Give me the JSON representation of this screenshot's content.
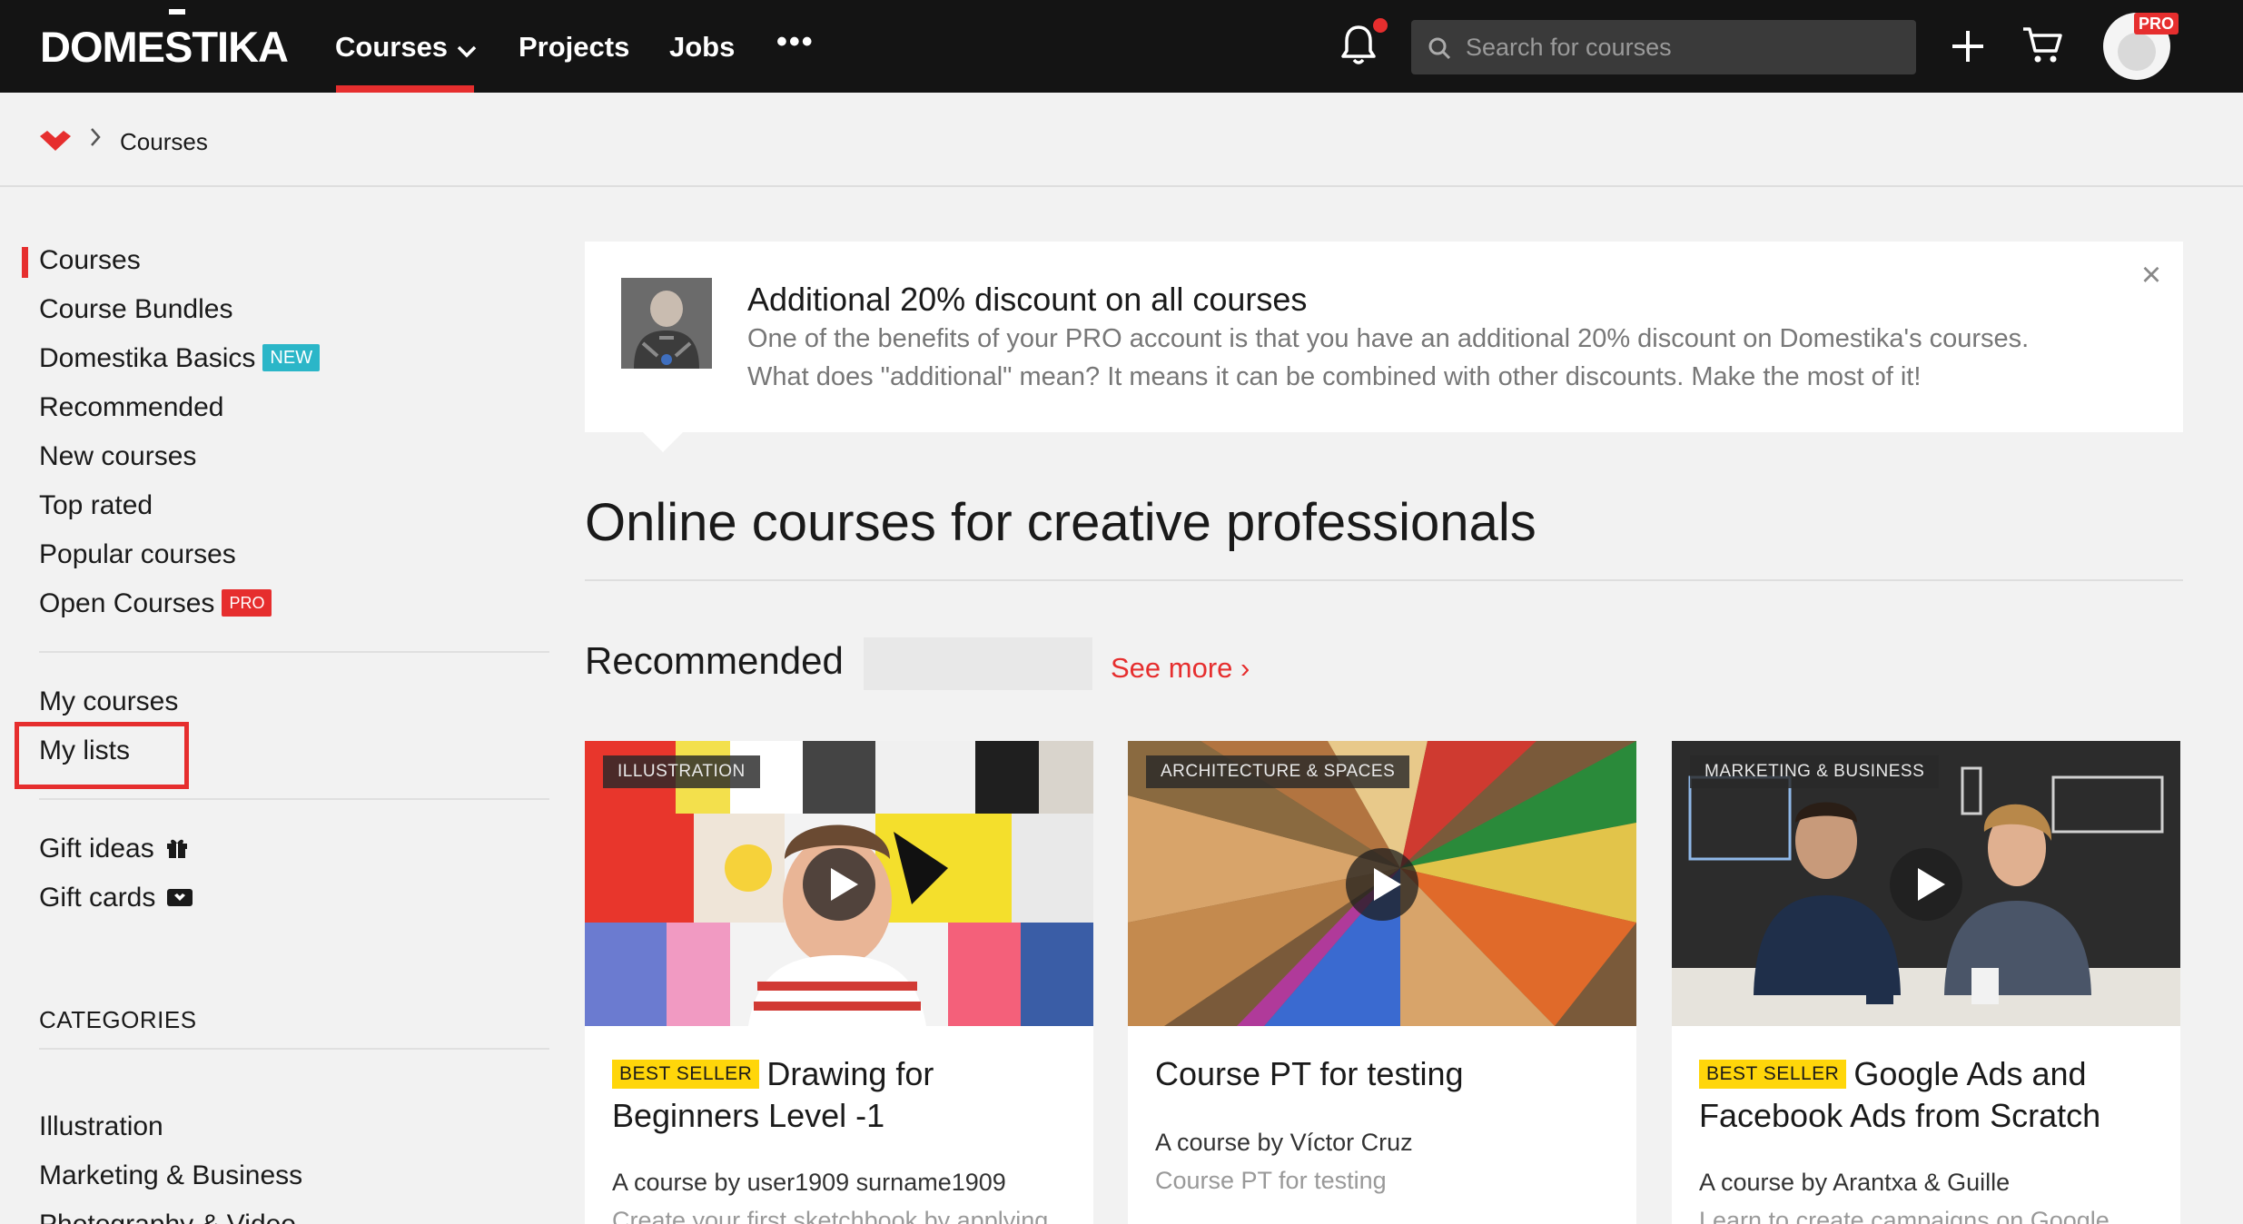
{
  "topnav": {
    "logo": "DOMESTIKA",
    "courses_label": "Courses",
    "projects_label": "Projects",
    "jobs_label": "Jobs",
    "more_label": "•••",
    "search_placeholder": "Search for courses",
    "pro_badge": "PRO",
    "accent_color": "#e62e2e"
  },
  "breadcrumb": {
    "home_icon": "domestika-heart-icon",
    "separator": ">",
    "current": "Courses"
  },
  "sidebar": {
    "items": [
      {
        "label": "Courses",
        "active": true
      },
      {
        "label": "Course Bundles"
      },
      {
        "label": "Domestika Basics",
        "badge": "NEW"
      },
      {
        "label": "Recommended"
      },
      {
        "label": "New courses"
      },
      {
        "label": "Top rated"
      },
      {
        "label": "Popular courses"
      },
      {
        "label": "Open Courses",
        "badge": "PRO"
      }
    ],
    "user_items": [
      {
        "label": "My courses"
      },
      {
        "label": "My lists",
        "highlighted": true
      }
    ],
    "gift_items": [
      {
        "label": "Gift ideas",
        "icon": "gift-icon"
      },
      {
        "label": "Gift cards",
        "icon": "gift-card-icon"
      }
    ],
    "categories_heading": "CATEGORIES",
    "categories": [
      "Illustration",
      "Marketing & Business",
      "Photography & Video"
    ]
  },
  "promo": {
    "title": "Additional 20% discount on all courses",
    "line1": "One of the benefits of your PRO account is that you have an additional 20% discount on Domestika's courses.",
    "line2": "What does \"additional\" mean? It means it can be combined with other discounts. Make the most of it!",
    "close": "×"
  },
  "main": {
    "title": "Online courses for creative professionals",
    "section_title": "Recommended",
    "see_more": "See more ›"
  },
  "cards": [
    {
      "category": "ILLUSTRATION",
      "badge": "BEST SELLER",
      "title": "Drawing for Beginners Level -1",
      "author": "A course by user1909 surname1909",
      "description": "Create your first sketchbook by applying"
    },
    {
      "category": "ARCHITECTURE & SPACES",
      "title": "Course PT for testing",
      "author": "A course by Víctor Cruz",
      "description": "Course PT for testing"
    },
    {
      "category": "MARKETING & BUSINESS",
      "badge": "BEST SELLER",
      "title": "Google Ads and Facebook Ads from Scratch",
      "author": "A course by Arantxa & Guille",
      "description": "Learn to create campaigns on Google"
    }
  ]
}
